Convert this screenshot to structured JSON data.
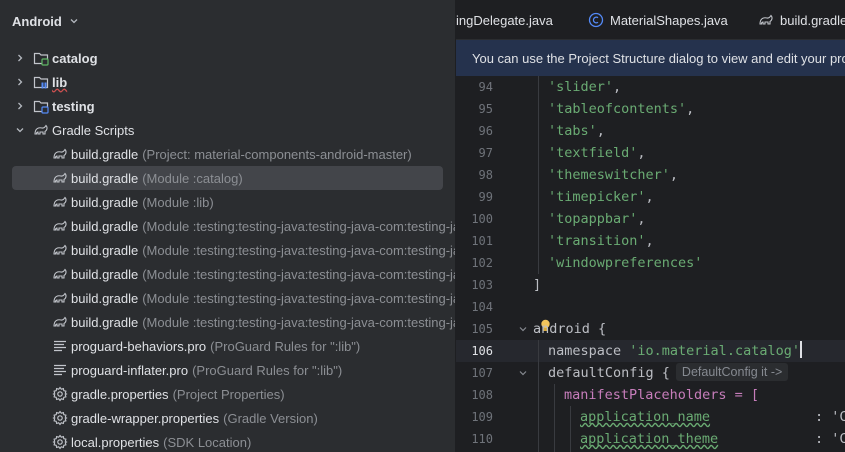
{
  "project_panel": {
    "view_mode": "Android",
    "tree": [
      {
        "name": "catalog",
        "desc": "",
        "type": "module-folder",
        "expanded": false
      },
      {
        "name": "lib",
        "desc": "",
        "type": "module-folder",
        "expanded": false
      },
      {
        "name": "testing",
        "desc": "",
        "type": "module-folder",
        "expanded": false
      },
      {
        "name": "Gradle Scripts",
        "desc": "",
        "type": "gradle-folder",
        "expanded": true
      },
      {
        "name": "build.gradle",
        "desc": "(Project: material-components-android-master)",
        "type": "gradle-file"
      },
      {
        "name": "build.gradle",
        "desc": "(Module :catalog)",
        "type": "gradle-file",
        "selected": true
      },
      {
        "name": "build.gradle",
        "desc": "(Module :lib)",
        "type": "gradle-file"
      },
      {
        "name": "build.gradle",
        "desc": "(Module :testing:testing-java:testing-java-com:testing-java-",
        "type": "gradle-file"
      },
      {
        "name": "build.gradle",
        "desc": "(Module :testing:testing-java:testing-java-com:testing-java-",
        "type": "gradle-file"
      },
      {
        "name": "build.gradle",
        "desc": "(Module :testing:testing-java:testing-java-com:testing-java-",
        "type": "gradle-file"
      },
      {
        "name": "build.gradle",
        "desc": "(Module :testing:testing-java:testing-java-com:testing-java-",
        "type": "gradle-file"
      },
      {
        "name": "build.gradle",
        "desc": "(Module :testing:testing-java:testing-java-com:testing-java-",
        "type": "gradle-file"
      },
      {
        "name": "proguard-behaviors.pro",
        "desc": "(ProGuard Rules for \":lib\")",
        "type": "text-file"
      },
      {
        "name": "proguard-inflater.pro",
        "desc": "(ProGuard Rules for \":lib\")",
        "type": "text-file"
      },
      {
        "name": "gradle.properties",
        "desc": "(Project Properties)",
        "type": "settings-file"
      },
      {
        "name": "gradle-wrapper.properties",
        "desc": "(Gradle Version)",
        "type": "settings-file"
      },
      {
        "name": "local.properties",
        "desc": "(SDK Location)",
        "type": "settings-file"
      }
    ]
  },
  "editor": {
    "tabs": [
      {
        "label": "ingDelegate.java",
        "icon": "java-class-icon"
      },
      {
        "label": "MaterialShapes.java",
        "icon": "java-class-icon"
      },
      {
        "label": "build.gradle",
        "icon": "gradle-icon"
      }
    ],
    "banner": "You can use the Project Structure dialog to view and edit your project",
    "lines": [
      {
        "num": "94",
        "text": "'slider'",
        "suffix": ","
      },
      {
        "num": "95",
        "text": "'tableofcontents'",
        "suffix": ","
      },
      {
        "num": "96",
        "text": "'tabs'",
        "suffix": ","
      },
      {
        "num": "97",
        "text": "'textfield'",
        "suffix": ","
      },
      {
        "num": "98",
        "text": "'themeswitcher'",
        "suffix": ","
      },
      {
        "num": "99",
        "text": "'timepicker'",
        "suffix": ","
      },
      {
        "num": "100",
        "text": "'topappbar'",
        "suffix": ","
      },
      {
        "num": "101",
        "text": "'transition'",
        "suffix": ","
      },
      {
        "num": "102",
        "text": "'windowpreferences'",
        "suffix": ""
      },
      {
        "num": "103",
        "text": "]",
        "suffix": ""
      },
      {
        "num": "104",
        "text": "",
        "suffix": ""
      },
      {
        "num": "105",
        "text": "android {",
        "suffix": ""
      },
      {
        "num": "106",
        "text": "namespace 'io.material.catalog'",
        "suffix": ""
      },
      {
        "num": "107",
        "text": "defaultConfig {",
        "suffix": ""
      },
      {
        "num": "108",
        "text": "manifestPlaceholders = [",
        "suffix": ""
      },
      {
        "num": "109",
        "text": "application_name",
        "suffix": ": 'C"
      },
      {
        "num": "110",
        "text": "application_theme",
        "suffix": ": 'C"
      }
    ],
    "inlay_hint": "DefaultConfig it ->",
    "current_line": "106"
  },
  "colors": {
    "panel_bg": "#2b2d30",
    "editor_bg": "#1e1f22",
    "selection": "#43454a",
    "banner_bg": "#25324d",
    "string": "#6aab73",
    "property": "#c77dbb",
    "line_number": "#6f737a"
  }
}
